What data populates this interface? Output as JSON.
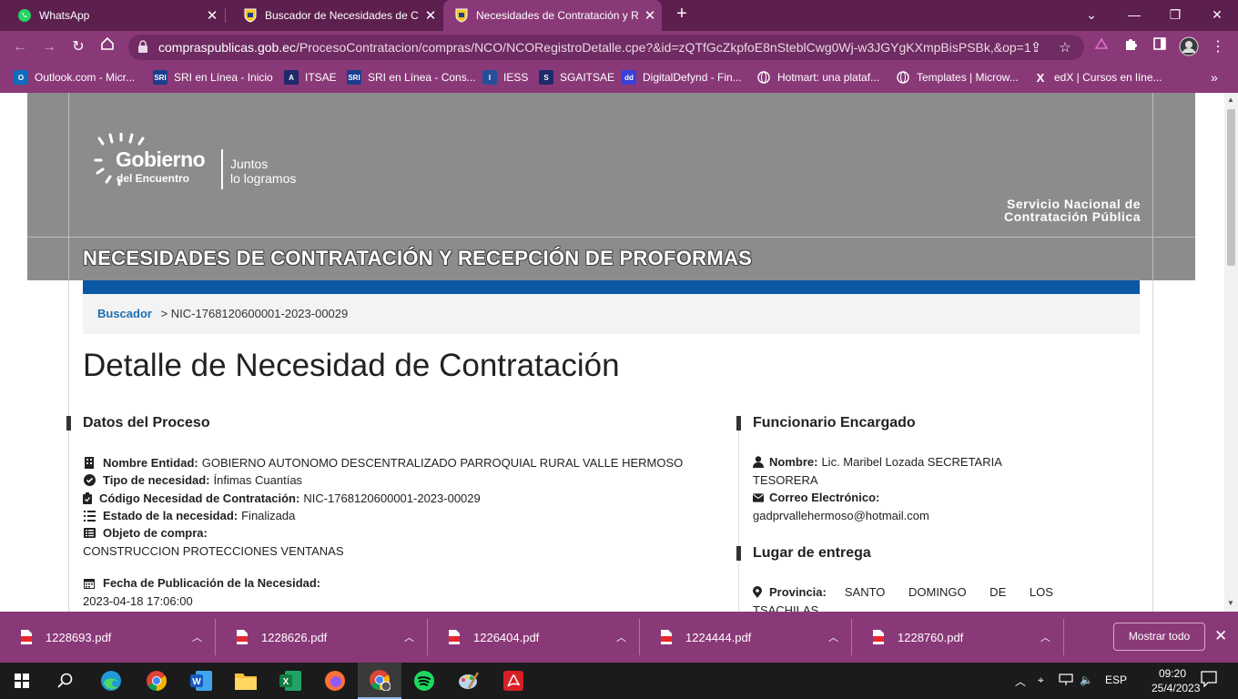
{
  "tabs": [
    {
      "title": "WhatsApp",
      "icon": "whatsapp-icon"
    },
    {
      "title": "Buscador de Necesidades de Con",
      "icon": "ecuador-shield-icon"
    },
    {
      "title": "Necesidades de Contratación y R",
      "icon": "ecuador-shield-icon",
      "active": true
    }
  ],
  "address_bar": {
    "host": "compraspublicas.gob.ec",
    "path": "/ProcesoContratacion/compras/NCO/NCORegistroDetalle.cpe?&id=zQTfGcZkpfoE8nSteblCwg0Wj-w3JGYgKXmpBisPSBk,&op=1"
  },
  "bookmarks": [
    {
      "label": "Outlook.com - Micr...",
      "icon": "outlook-icon",
      "color": "#0f6cbd",
      "abbr": "O"
    },
    {
      "label": "SRI en Línea - Inicio",
      "icon": "sri-icon",
      "color": "#1a3d8f",
      "abbr": "SRI"
    },
    {
      "label": "ITSAE",
      "icon": "itsae-icon",
      "color": "#1d2a6b",
      "abbr": "A"
    },
    {
      "label": "SRI en Línea - Cons...",
      "icon": "sri-icon",
      "color": "#1a3d8f",
      "abbr": "SRI"
    },
    {
      "label": "IESS",
      "icon": "iess-icon",
      "color": "#274e9b",
      "abbr": "I"
    },
    {
      "label": "SGAITSAE",
      "icon": "sga-icon",
      "color": "#1d2a6b",
      "abbr": "S"
    },
    {
      "label": "DigitalDefynd - Fin...",
      "icon": "digitaldefynd-icon",
      "color": "#3a3fd8",
      "abbr": "dd"
    },
    {
      "label": "Hotmart: una plataf...",
      "icon": "globe-icon",
      "color": "#8a3978",
      "abbr": ""
    },
    {
      "label": "Templates | Microw...",
      "icon": "globe-icon",
      "color": "#8a3978",
      "abbr": ""
    },
    {
      "label": "edX | Cursos en líne...",
      "icon": "edx-icon",
      "color": "#8a3978",
      "abbr": "X"
    }
  ],
  "hero": {
    "logo_line1": "Gobierno",
    "logo_line2": "del Encuentro",
    "slogan_line1": "Juntos",
    "slogan_line2": "lo logramos",
    "agency_line1": "Servicio Nacional de",
    "agency_line2": "Contratación Pública",
    "banner_title": "NECESIDADES DE CONTRATACIÓN Y RECEPCIÓN DE PROFORMAS"
  },
  "breadcrumb": {
    "link": "Buscador",
    "current": "> NIC-1768120600001-2023-00029"
  },
  "page_title": "Detalle de Necesidad de Contratación",
  "datos_proceso": {
    "heading": "Datos del Proceso",
    "nombre_label": "Nombre Entidad:",
    "nombre_value": "GOBIERNO AUTONOMO DESCENTRALIZADO PARROQUIAL RURAL VALLE HERMOSO",
    "tipo_label": "Tipo de necesidad:",
    "tipo_value": "Ínfimas Cuantías",
    "codigo_label": "Código Necesidad de Contratación:",
    "codigo_value": "NIC-1768120600001-2023-00029",
    "estado_label": "Estado de la necesidad:",
    "estado_value": "Finalizada",
    "objeto_label": "Objeto de compra:",
    "objeto_value": "CONSTRUCCION PROTECCIONES VENTANAS",
    "fecha_label": "Fecha de Publicación de la Necesidad:",
    "fecha_value": "2023-04-18 17:06:00"
  },
  "funcionario": {
    "heading": "Funcionario Encargado",
    "nombre_label": "Nombre:",
    "nombre_value": "Lic. Maribel Lozada SECRETARIA",
    "nombre_value2": "TESORERA",
    "correo_label": "Correo Electrónico:",
    "correo_value": "gadprvallehermoso@hotmail.com"
  },
  "lugar": {
    "heading": "Lugar de entrega",
    "provincia_label": "Provincia:",
    "provincia_value": "SANTO DOMINGO DE LOS",
    "provincia_value2": "TSACHILAS"
  },
  "downloads": {
    "files": [
      "1228693.pdf",
      "1228626.pdf",
      "1226404.pdf",
      "1224444.pdf",
      "1228760.pdf"
    ],
    "show_all": "Mostrar todo"
  },
  "taskbar": {
    "apps": [
      "windows-start-icon",
      "search-icon",
      "edge-icon",
      "chrome-icon",
      "word-icon",
      "file-explorer-icon",
      "excel-icon",
      "firefox-icon",
      "chrome-profile-icon",
      "spotify-icon",
      "paint-icon",
      "acrobat-icon"
    ],
    "language": "ESP",
    "time": "09:20",
    "date": "25/4/2023"
  }
}
